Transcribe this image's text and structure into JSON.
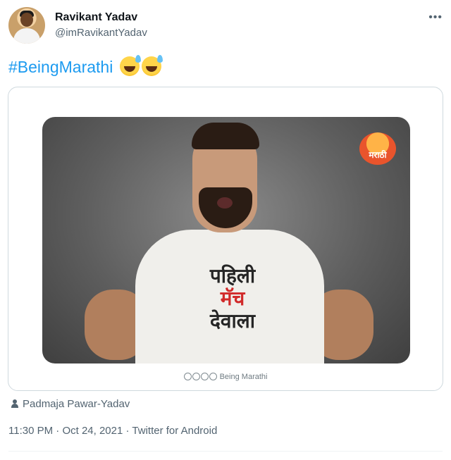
{
  "author": {
    "name": "Ravikant Yadav",
    "handle": "@imRavikantYadav"
  },
  "tweet": {
    "hashtag": "#BeingMarathi",
    "emojis": [
      "😅",
      "😅"
    ]
  },
  "media": {
    "badge_text": "मराठी",
    "shirt_text": [
      "पहिली",
      "मॅच",
      "देवाला"
    ],
    "credit": "Being Marathi"
  },
  "caption": {
    "credit_name": "Padmaja Pawar-Yadav"
  },
  "meta": {
    "time": "11:30 PM",
    "date": "Oct 24, 2021",
    "source": "Twitter for Android"
  },
  "colors": {
    "link": "#1d9bf0",
    "secondary_text": "#536471"
  },
  "icons": [
    "more-icon",
    "user-icon",
    "social-icons"
  ]
}
